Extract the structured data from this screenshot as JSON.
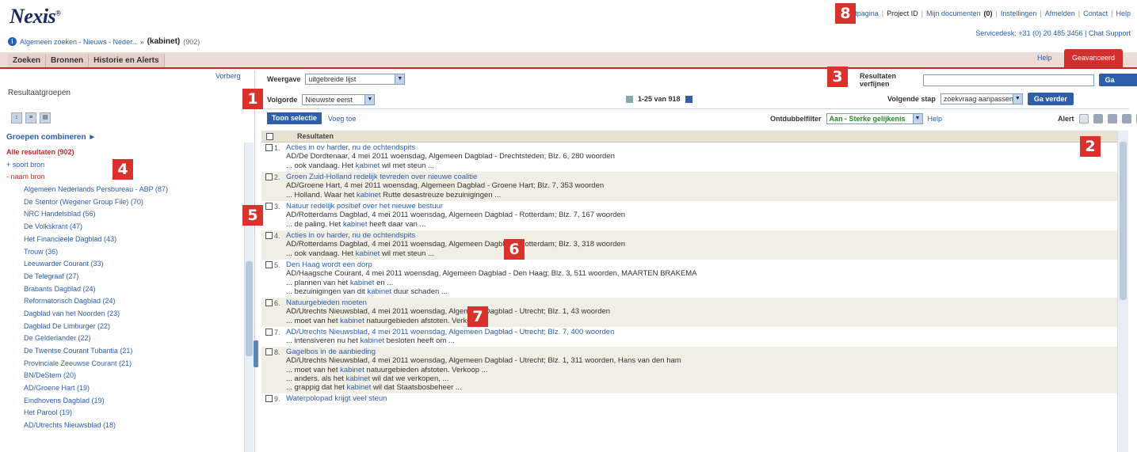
{
  "header": {
    "logo": "Nexis",
    "top_links": [
      "Startpagina",
      "Project ID",
      "Mijn documenten",
      "(0)",
      "Instellingen",
      "Afmelden",
      "Contact",
      "Help"
    ],
    "service_desk": "Servicedesk: +31 (0) 20 485 3456 | Chat Support",
    "breadcrumb_path": "Algemeen zoeken - Nieuws - Neder... »",
    "breadcrumb_current": "(kabinet)",
    "breadcrumb_count": "(902)"
  },
  "tabs": [
    "Zoeken",
    "Bronnen",
    "Historie en Alerts"
  ],
  "help_link": "Help",
  "red_button": "Geavanceerd",
  "sidebar": {
    "vorige": "Vorberg",
    "title": "Resultaatgroepen",
    "groepen": "Groepen combineren ►",
    "all_results": "Alle resultaten (902)",
    "soort_bron": "+ soort bron",
    "naam_bron": "- naam bron",
    "sources": [
      "Algemeen Nederlands Persbureau - ABP (87)",
      "De Stentor (Wegener Group File) (70)",
      "NRC Handelsblad (56)",
      "De Volkskrant (47)",
      "Het Financieele Dagblad (43)",
      "Trouw (36)",
      "Leeuwarder Courant (33)",
      "De Telegraaf (27)",
      "Brabants Dagblad (24)",
      "Reformatorisch Dagblad (24)",
      "Dagblad van het Noorden (23)",
      "Dagblad De Limburger (22)",
      "De Gelderlander (22)",
      "De Twentse Courant Tubantia (21)",
      "Provinciale Zeeuwse Courant (21)",
      "BN/DeStem (20)",
      "AD/Groene Hart (19)",
      "Eindhovens Dagblad (19)",
      "Het Parool (19)",
      "AD/Utrechts Nieuwsblad (18)"
    ]
  },
  "toolbar": {
    "weergave_label": "Weergave",
    "weergave_value": "uitgebreide lijst",
    "volgorde_label": "Volgorde",
    "volgorde_value": "Nieuwste eerst",
    "paging": "1-25 van 918",
    "verfijnen_label": "Resultaten verfijnen",
    "ga_verder": "Ga verder",
    "volgende_stap_label": "Volgende stap",
    "volgende_stap_value": "zoekvraag aanpassen",
    "toon_selectie": "Toon selectie",
    "voeg_toe": "Voeg toe",
    "dubbel_label": "Ontdubbelfilter",
    "dubbel_value": "Aan - Sterke gelijkenis",
    "dubbel_help": "Help",
    "alert": "Alert"
  },
  "results": {
    "header": "Resultaten",
    "items": [
      {
        "num": "1.",
        "title": "Acties in ov harder, nu de ochtendspits",
        "meta": "AD/De Dordtenaar, 4 mei 2011 woensdag, Algemeen Dagblad - Drechtsteden; Blz. 6, 280 woorden",
        "snippets": [
          [
            "... ook vandaag. Het ",
            "kabinet",
            " wil met steun ..."
          ]
        ]
      },
      {
        "num": "2.",
        "title": "Groen Zuid-Holland redelijk tevreden over nieuwe coalitie",
        "meta": "AD/Groene Hart, 4 mei 2011 woensdag, Algemeen Dagblad - Groene Hart; Blz. 7, 353 woorden",
        "snippets": [
          [
            "... Holland. Waar het ",
            "kabinet",
            " Rutte desastreuze bezuinigingen ..."
          ]
        ]
      },
      {
        "num": "3.",
        "title": "Natuur redelijk positief over het nieuwe bestuur",
        "meta": "AD/Rotterdams Dagblad, 4 mei 2011 woensdag, Algemeen Dagblad - Rotterdam; Blz. 7, 167 woorden",
        "snippets": [
          [
            "... de paling. Het ",
            "kabinet",
            " heeft daar van ..."
          ]
        ]
      },
      {
        "num": "4.",
        "title": "Acties in ov harder, nu de ochtendspits",
        "meta": "AD/Rotterdams Dagblad, 4 mei 2011 woensdag, Algemeen Dagblad - Rotterdam; Blz. 3, 318 woorden",
        "snippets": [
          [
            "... ook vandaag. Het ",
            "kabinet",
            " wil met steun ..."
          ]
        ]
      },
      {
        "num": "5.",
        "title": "Den Haag wordt een dorp",
        "meta": "AD/Haagsche Courant, 4 mei 2011 woensdag, Algemeen Dagblad - Den Haag; Blz. 3, 511 woorden, MAARTEN BRAKEMA",
        "snippets": [
          [
            "... plannen van het ",
            "kabinet",
            " en ..."
          ],
          [
            "... bezuinigingen van dit ",
            "kabinet",
            " duur schaden ..."
          ]
        ]
      },
      {
        "num": "6.",
        "title": "Natuurgebieden moeten",
        "meta": "AD/Utrechts Nieuwsblad, 4 mei 2011 woensdag, Algemeen Dagblad - Utrecht; Blz. 1, 43 woorden",
        "snippets": [
          [
            "... moet van het ",
            "kabinet",
            " natuurgebieden afstoten. Verkoop ..."
          ]
        ]
      },
      {
        "num": "7.",
        "title": "AD/Utrechts Nieuwsblad, 4 mei 2011 woensdag, Algemeen Dagblad - Utrecht; Blz. 7, 400 woorden",
        "meta": "",
        "snippets": [
          [
            "... intensiveren nu het ",
            "kabinet",
            " besloten heeft om ..."
          ]
        ]
      },
      {
        "num": "8.",
        "title": "Gagelbos in de aanbieding",
        "meta": "AD/Utrechts Nieuwsblad, 4 mei 2011 woensdag, Algemeen Dagblad - Utrecht; Blz. 1, 311 woorden, Hans van den ham",
        "snippets": [
          [
            "... moet van het ",
            "kabinet",
            " natuurgebieden afstoten. Verkoop ..."
          ],
          [
            "... anders. als het ",
            "kabinet",
            " wil dat we verkopen, ..."
          ],
          [
            "... grappig dat het ",
            "kabinet",
            " wil dat Staatsbosbeheer ..."
          ]
        ]
      },
      {
        "num": "9.",
        "title": "Waterpolopad krijgt veel steun",
        "meta": "",
        "snippets": []
      }
    ]
  },
  "callouts": [
    "1",
    "2",
    "3",
    "4",
    "5",
    "6",
    "7",
    "8"
  ],
  "colors": {
    "accent": "#2f5fa8",
    "brand_red": "#d9322d",
    "link": "#2a5db0"
  }
}
